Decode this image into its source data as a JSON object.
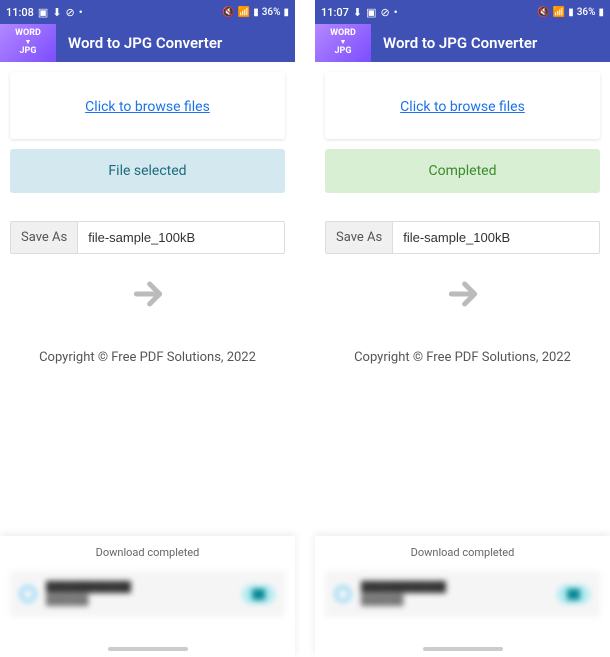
{
  "screens": [
    {
      "status": {
        "time": "11:08",
        "battery": "36%"
      },
      "app_title": "Word to JPG Converter",
      "browse_label": "Click to browse files",
      "file_status": {
        "text": "File selected",
        "kind": "selected"
      },
      "save_label": "Save As",
      "save_value": "file-sample_100kB",
      "copyright": "Copyright © Free PDF Solutions, 2022",
      "download_header": "Download completed"
    },
    {
      "status": {
        "time": "11:07",
        "battery": "36%"
      },
      "app_title": "Word to JPG Converter",
      "browse_label": "Click to browse files",
      "file_status": {
        "text": "Completed",
        "kind": "completed"
      },
      "save_label": "Save As",
      "save_value": "file-sample_100kB",
      "copyright": "Copyright © Free PDF Solutions, 2022",
      "download_header": "Download completed"
    }
  ],
  "icon_text": {
    "word": "WORD",
    "jpg": "JPG"
  }
}
